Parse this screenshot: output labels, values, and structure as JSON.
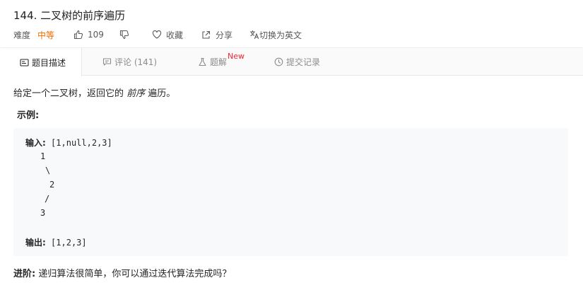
{
  "problem": {
    "title": "144. 二叉树的前序遍历",
    "difficulty_label": "难度",
    "difficulty_value": "中等",
    "likes": "109",
    "favorite_label": "收藏",
    "share_label": "分享",
    "switch_lang_label": "切换为英文"
  },
  "tabs": {
    "description": "题目描述",
    "comments": "评论 (141)",
    "solutions": "题解",
    "solutions_badge": "New",
    "submissions": "提交记录"
  },
  "content": {
    "intro_before": "给定一个二叉树，返回它的 ",
    "intro_emphasis": "前序",
    "intro_after": " 遍历。",
    "example_label": "示例:",
    "input_label": "输入:",
    "input_value": "[1,null,2,3]",
    "tree_lines": [
      "1",
      "\\",
      "2",
      "/",
      "3"
    ],
    "output_label": "输出:",
    "output_value": "[1,2,3]",
    "advance_label": "进阶:",
    "advance_text": " 递归算法很简单，你可以通过迭代算法完成吗？"
  },
  "colors": {
    "difficulty_medium": "#ef6c00",
    "new_badge": "#f5222d",
    "code_background": "#f7f9fa"
  }
}
